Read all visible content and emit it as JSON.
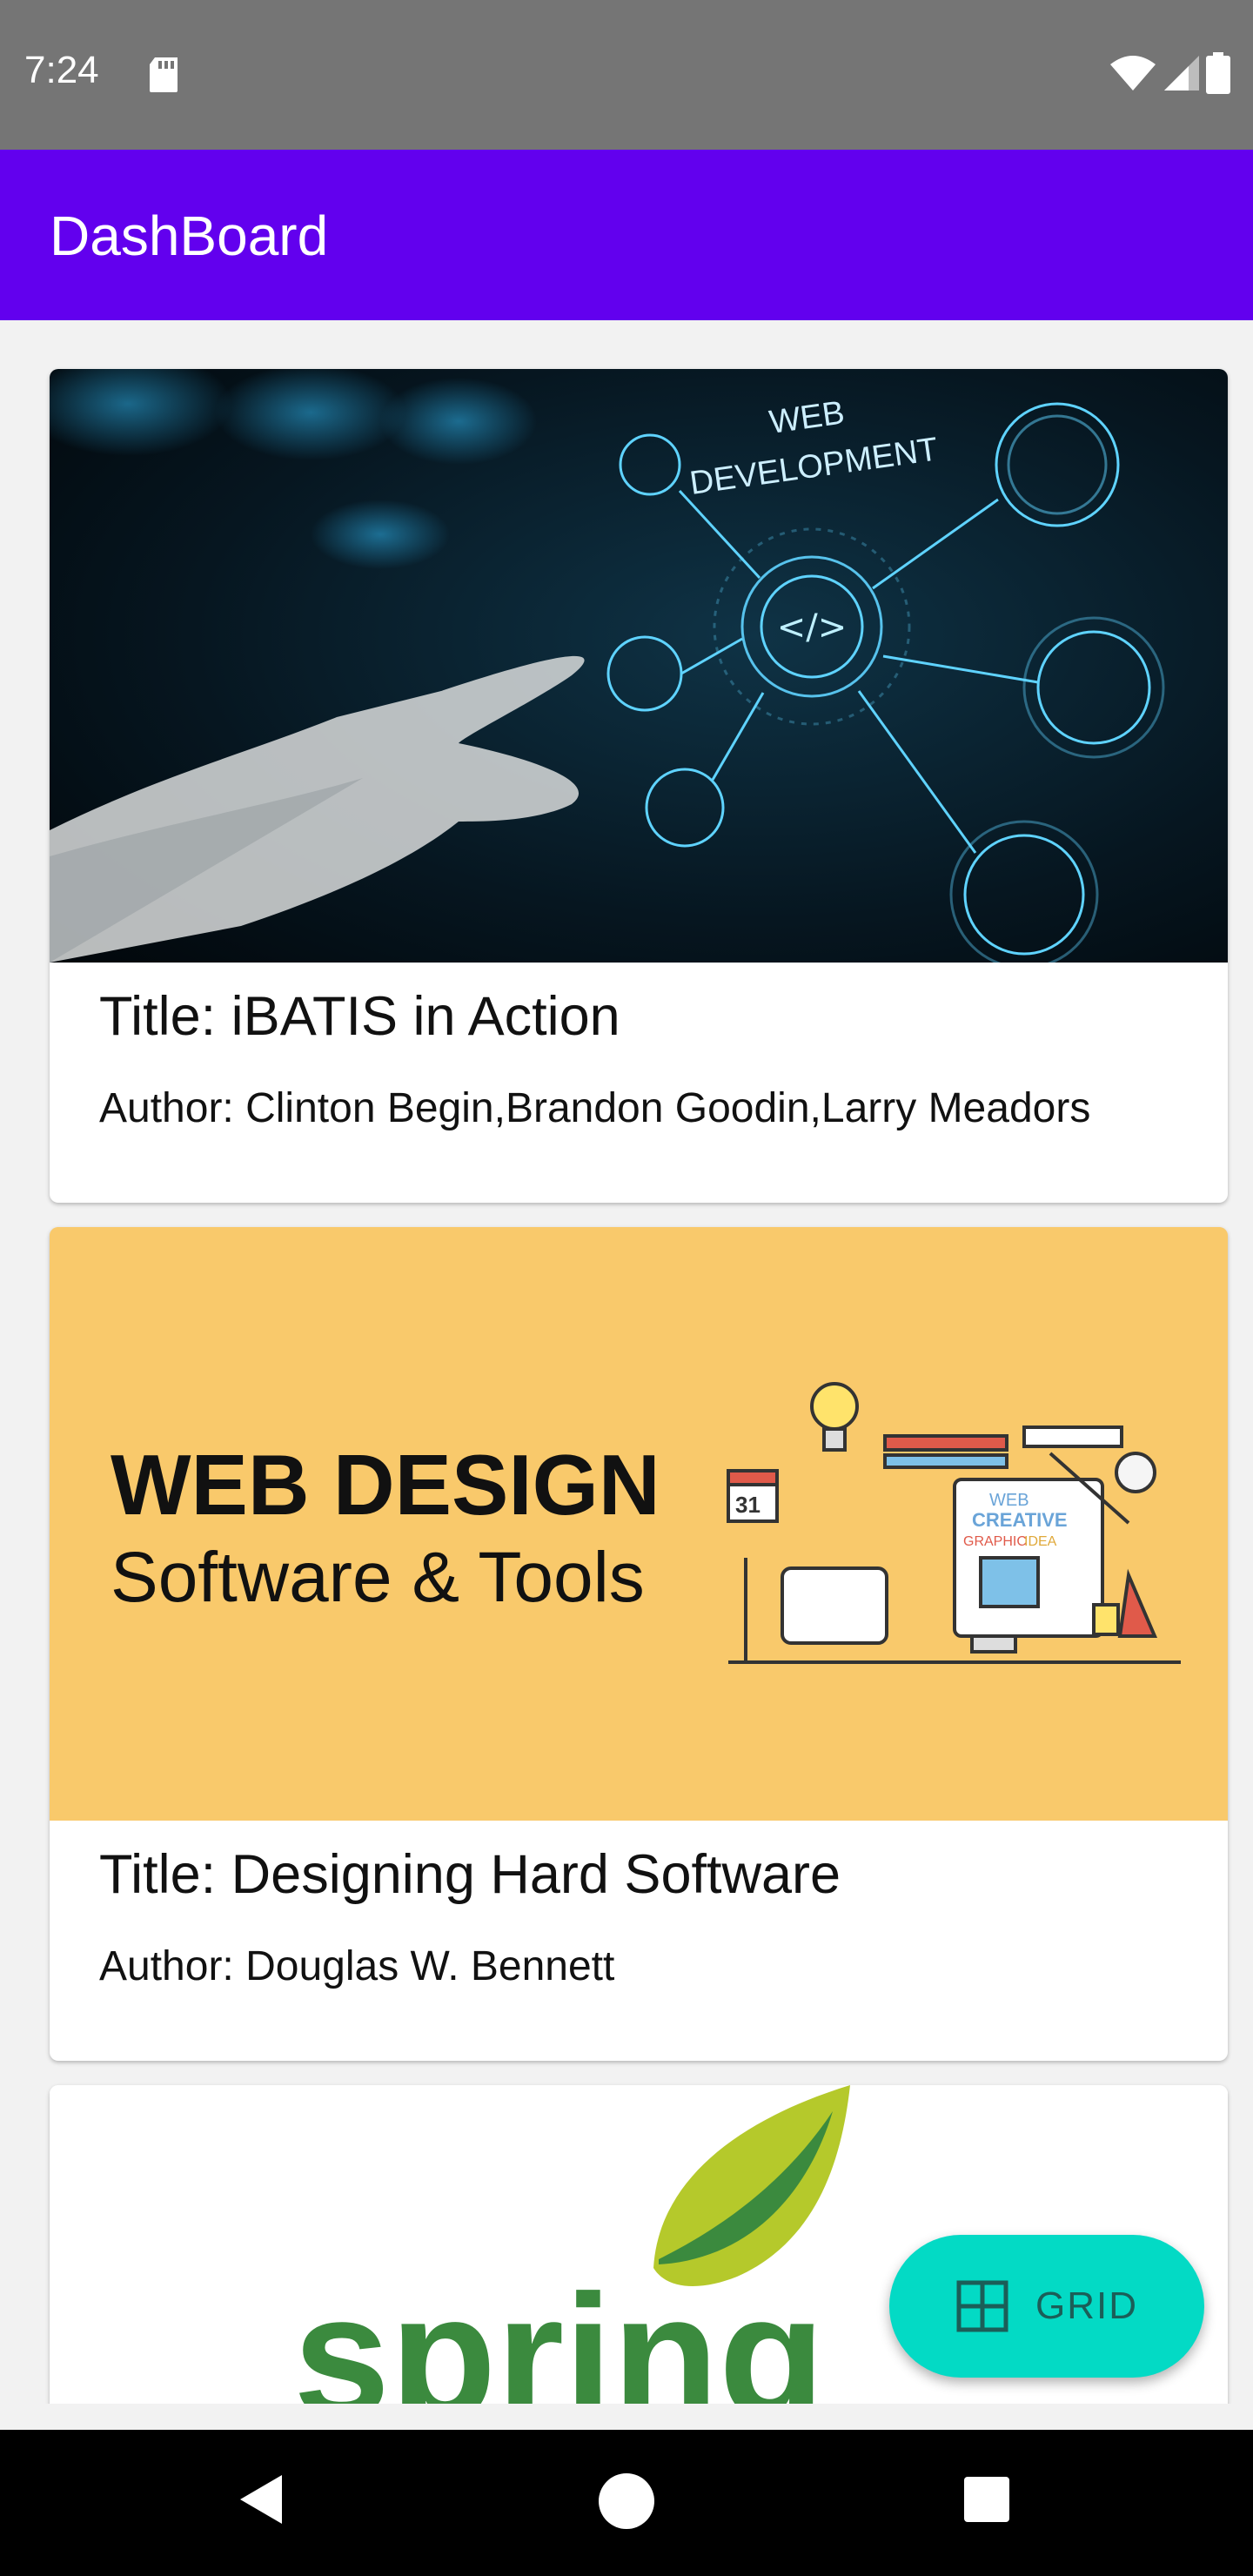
{
  "status_bar": {
    "time": "7:24"
  },
  "app_bar": {
    "title": "DashBoard"
  },
  "books": [
    {
      "title": "Title: iBATIS in Action",
      "author": "Author: Clinton Begin,Brandon Goodin,Larry Meadors",
      "image_text": {
        "line1": "WEB",
        "line2": "DEVELOPMENT"
      }
    },
    {
      "title": "Title: Designing Hard Software",
      "author": "Author: Douglas W. Bennett",
      "image_text": {
        "line1": "WEB DESIGN",
        "line2": "Software & Tools",
        "calendar": "31",
        "creative_1": "WEB",
        "creative_2": "CREATIVE",
        "creative_3": "GRAPHIC",
        "creative_4": "IDEA"
      }
    },
    {
      "image_text": {
        "logo": "spring"
      }
    }
  ],
  "fab": {
    "label": "GRID",
    "icon": "grid-icon"
  },
  "colors": {
    "primary": "#6200ee",
    "accent": "#03dac5",
    "status_bar": "#757575",
    "spring_green": "#3b8a3e",
    "leaf": "#b5c92b"
  }
}
